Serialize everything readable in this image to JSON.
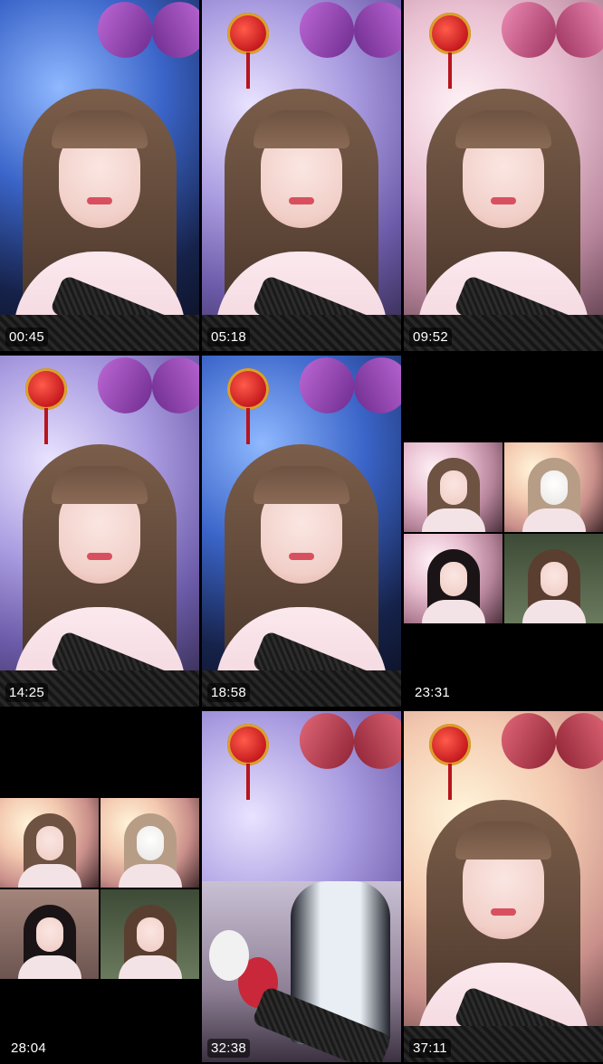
{
  "grid": {
    "tiles": [
      {
        "timestamp": "00:45",
        "kind": "single",
        "theme": "blue"
      },
      {
        "timestamp": "05:18",
        "kind": "single",
        "theme": "lilac"
      },
      {
        "timestamp": "09:52",
        "kind": "single",
        "theme": "pink"
      },
      {
        "timestamp": "14:25",
        "kind": "single",
        "theme": "lilac"
      },
      {
        "timestamp": "18:58",
        "kind": "single",
        "theme": "blue"
      },
      {
        "timestamp": "23:31",
        "kind": "multi",
        "theme": "black"
      },
      {
        "timestamp": "28:04",
        "kind": "multi",
        "theme": "black"
      },
      {
        "timestamp": "32:38",
        "kind": "room",
        "theme": "lilac"
      },
      {
        "timestamp": "37:11",
        "kind": "single",
        "theme": "warm"
      }
    ]
  },
  "colors": {
    "background": "#000000",
    "timestamp_text": "#ffffff",
    "timestamp_bg": "rgba(0,0,0,0.55)"
  }
}
